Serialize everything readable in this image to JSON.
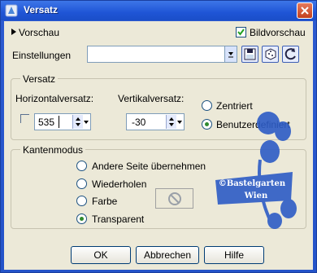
{
  "window": {
    "title": "Versatz",
    "icon": "app-icon",
    "close_icon": "close-icon"
  },
  "top": {
    "preview_label": "Vorschau",
    "preview_expand_icon": "triangle-right-icon",
    "image_preview_label": "Bildvorschau",
    "image_preview_checked": true
  },
  "settings": {
    "label": "Einstellungen",
    "value": "",
    "buttons": [
      "save-preset-icon",
      "dice-icon",
      "reset-icon"
    ]
  },
  "offset": {
    "group_label": "Versatz",
    "horizontal_label": "Horizontalversatz:",
    "horizontal_value": "535",
    "vertical_label": "Vertikalversatz:",
    "vertical_value": "-30",
    "mode_centered": "Zentriert",
    "mode_custom": "Benutzerdefiniert",
    "selected_mode": "custom"
  },
  "edge_mode": {
    "group_label": "Kantenmodus",
    "options": [
      "Andere Seite übernehmen",
      "Wiederholen",
      "Farbe",
      "Transparent"
    ],
    "selected": "Transparent",
    "color_swatch_icon": "no-symbol-icon"
  },
  "watermark": {
    "text_line1": "©Bastelgarten",
    "text_line2": "Wien"
  },
  "buttons": {
    "ok": "OK",
    "cancel": "Abbrechen",
    "help": "Hilfe"
  }
}
